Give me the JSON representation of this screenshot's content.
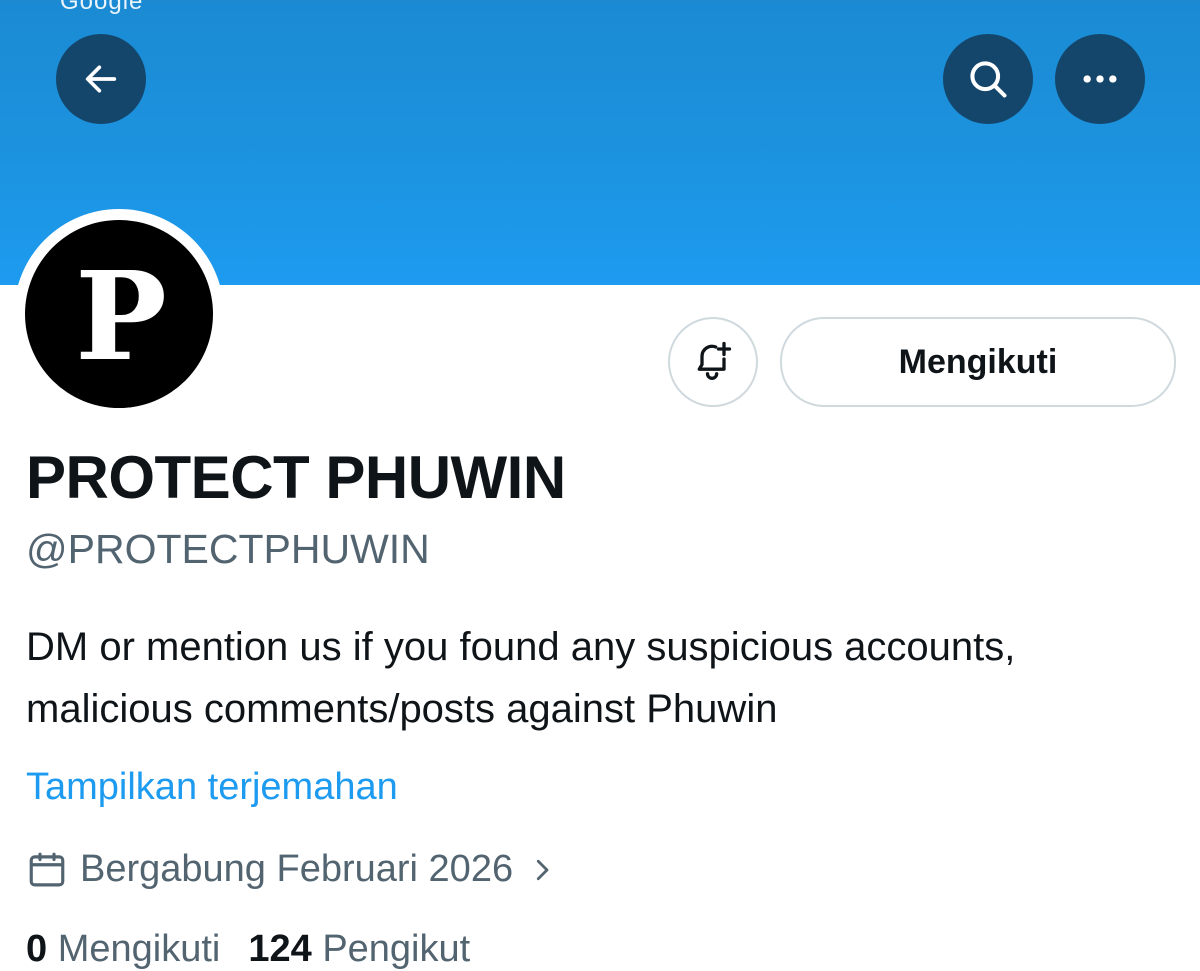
{
  "status_bar": {
    "fragment": "Google"
  },
  "header": {
    "back_icon": "arrow-left-icon",
    "search_icon": "search-icon",
    "more_icon": "more-horizontal-icon",
    "banner_color": "#1d9bf0",
    "button_color": "#14466c"
  },
  "profile": {
    "avatar_letter": "P",
    "display_name": "PROTECT PHUWIN",
    "handle": "@PROTECTPHUWIN",
    "bio": "DM or mention us if you found any suspicious accounts, malicious comments/posts against Phuwin",
    "translate_label": "Tampilkan terjemahan",
    "joined_label": "Bergabung Februari 2026"
  },
  "actions": {
    "notify_icon": "bell-plus-icon",
    "follow_label": "Mengikuti"
  },
  "stats": {
    "following_count": "0",
    "following_label": "Mengikuti",
    "followers_count": "124",
    "followers_label": "Pengikut"
  },
  "colors": {
    "accent": "#1d9bf0",
    "secondary_text": "#536471",
    "primary_text": "#0f1419",
    "border": "#cfd9de"
  }
}
